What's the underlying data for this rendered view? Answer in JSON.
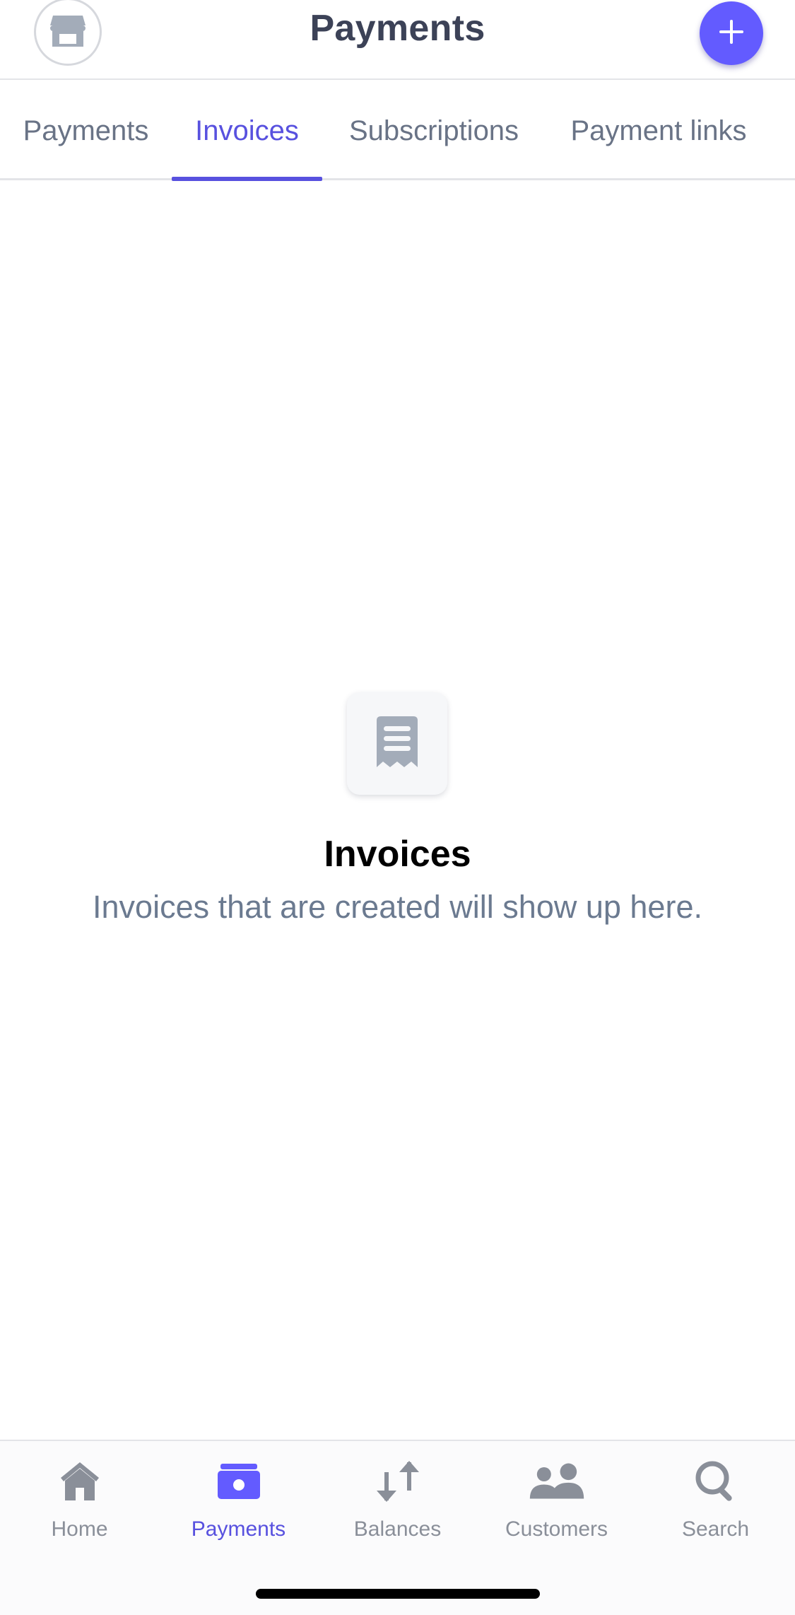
{
  "header": {
    "title": "Payments",
    "store_icon": "storefront-icon",
    "add_icon": "plus-icon"
  },
  "tabs": [
    {
      "label": "Payments",
      "active": false
    },
    {
      "label": "Invoices",
      "active": true
    },
    {
      "label": "Subscriptions",
      "active": false
    },
    {
      "label": "Payment links",
      "active": false
    }
  ],
  "empty_state": {
    "icon": "receipt-icon",
    "title": "Invoices",
    "subtitle": "Invoices that are created will show up here."
  },
  "bottom_nav": [
    {
      "label": "Home",
      "icon": "home-icon",
      "active": false
    },
    {
      "label": "Payments",
      "icon": "payments-icon",
      "active": true
    },
    {
      "label": "Balances",
      "icon": "balances-icon",
      "active": false
    },
    {
      "label": "Customers",
      "icon": "customers-icon",
      "active": false
    },
    {
      "label": "Search",
      "icon": "search-icon",
      "active": false
    }
  ],
  "colors": {
    "accent": "#635bff",
    "active_text": "#5851df",
    "muted_text": "#697386",
    "title_text": "#3c4257",
    "nav_inactive": "#8a8f99"
  }
}
